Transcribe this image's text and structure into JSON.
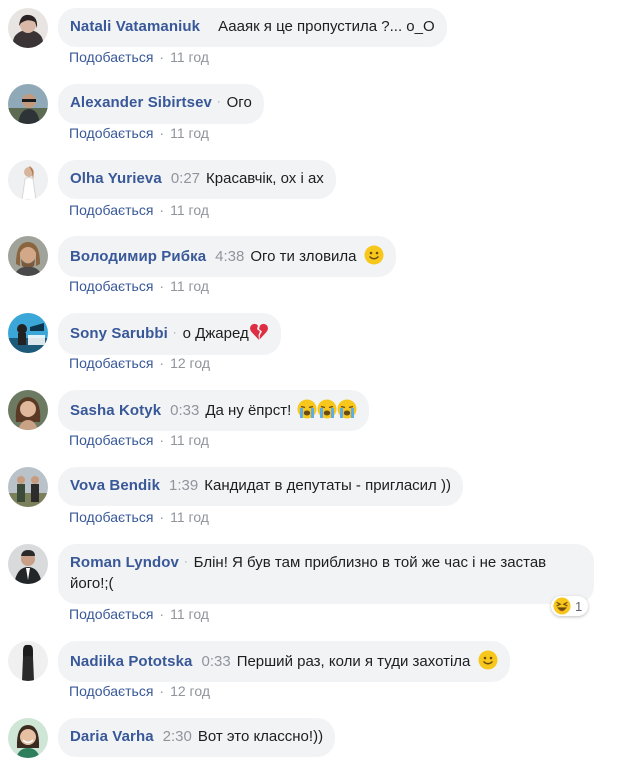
{
  "comments": [
    {
      "author": "Natali Vatamaniuk",
      "time": "",
      "separator": "",
      "text": "Аааяк я це пропустила ?... о_О",
      "like_label": "Подобається",
      "age": "11 год",
      "avatar": "avatar-woman-dark-hair"
    },
    {
      "author": "Alexander Sibirtsev",
      "time": "",
      "separator": "·",
      "text": "Ого",
      "like_label": "Подобається",
      "age": "11 год",
      "avatar": "avatar-man-outdoor"
    },
    {
      "author": "Olha Yurieva",
      "time": "0:27",
      "separator": "",
      "text": "Красавчік, ох і ах",
      "like_label": "Подобається",
      "age": "11 год",
      "avatar": "avatar-woman-white-dress"
    },
    {
      "author": "Володимир Рибка",
      "time": "4:38",
      "separator": "",
      "text": "Ого ти зловила",
      "emoji": "smile",
      "like_label": "Подобається",
      "age": "11 год",
      "avatar": "avatar-man-long-hair"
    },
    {
      "author": "Sony Sarubbi",
      "time": "",
      "separator": "·",
      "text": "о Джаред",
      "emoji": "broken-heart",
      "like_label": "Подобається",
      "age": "12 год",
      "avatar": "avatar-blue-poster"
    },
    {
      "author": "Sasha Kotyk",
      "time": "0:33",
      "separator": "",
      "text": "Да ну ёпрст!",
      "emoji": "crying-x3",
      "like_label": "Подобається",
      "age": "11 год",
      "avatar": "avatar-woman-curly"
    },
    {
      "author": "Vova Bendik",
      "time": "1:39",
      "separator": "",
      "text": "Кандидат в депутаты - пригласил ))",
      "like_label": "Подобається",
      "age": "11 год",
      "avatar": "avatar-two-men"
    },
    {
      "author": "Roman Lyndov",
      "time": "",
      "separator": "·",
      "text": "Блін! Я був там приблизно в той же час і не застав його!;(",
      "like_label": "Подобається",
      "age": "11 год",
      "avatar": "avatar-man-suit",
      "reaction": {
        "emoji": "laughing",
        "count": "1"
      }
    },
    {
      "author": "Nadiika Pototska",
      "time": "0:33",
      "separator": "",
      "text": "Перший раз, коли я туди захотіла",
      "emoji": "smile",
      "like_label": "Подобається",
      "age": "12 год",
      "avatar": "avatar-woman-standing"
    },
    {
      "author": "Daria Varha",
      "time": "2:30",
      "separator": "",
      "text": "Вот это классно!))",
      "like_label": "",
      "age": "",
      "avatar": "avatar-woman-smiling"
    }
  ],
  "colors": {
    "bubble": "#f2f3f5",
    "author": "#385898",
    "meta": "#90949c",
    "text": "#1c1e21"
  }
}
